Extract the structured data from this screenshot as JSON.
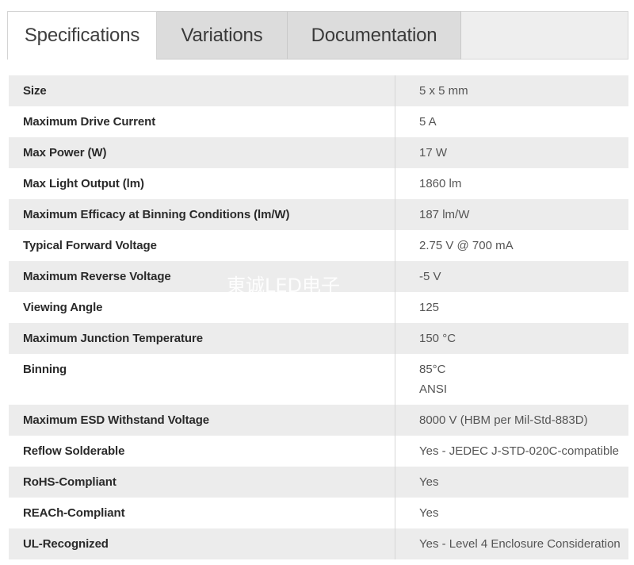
{
  "tabs": [
    {
      "label": "Specifications",
      "active": true
    },
    {
      "label": "Variations",
      "active": false
    },
    {
      "label": "Documentation",
      "active": false
    }
  ],
  "specs": [
    {
      "label": "Size",
      "value": "5 x 5 mm"
    },
    {
      "label": "Maximum Drive Current",
      "value": "5 A"
    },
    {
      "label": "Max Power (W)",
      "value": "17 W"
    },
    {
      "label": "Max Light Output (lm)",
      "value": "1860 lm"
    },
    {
      "label": "Maximum Efficacy at Binning Conditions (lm/W)",
      "value": "187 lm/W"
    },
    {
      "label": "Typical Forward Voltage",
      "value": "2.75 V @ 700 mA"
    },
    {
      "label": "Maximum Reverse Voltage",
      "value": "-5 V"
    },
    {
      "label": "Viewing Angle",
      "value": "125"
    },
    {
      "label": "Maximum Junction Temperature",
      "value": "150 °C"
    },
    {
      "label": "Binning",
      "value": "85°C",
      "value2": "ANSI"
    },
    {
      "label": "Maximum ESD Withstand Voltage",
      "value": "8000 V (HBM per Mil-Std-883D)"
    },
    {
      "label": "Reflow Solderable",
      "value": "Yes - JEDEC J-STD-020C-compatible"
    },
    {
      "label": "RoHS-Compliant",
      "value": "Yes"
    },
    {
      "label": "REACh-Compliant",
      "value": "Yes"
    },
    {
      "label": "UL-Recognized",
      "value": "Yes - Level 4 Enclosure Consideration"
    }
  ],
  "watermark": "東诚LED电子"
}
